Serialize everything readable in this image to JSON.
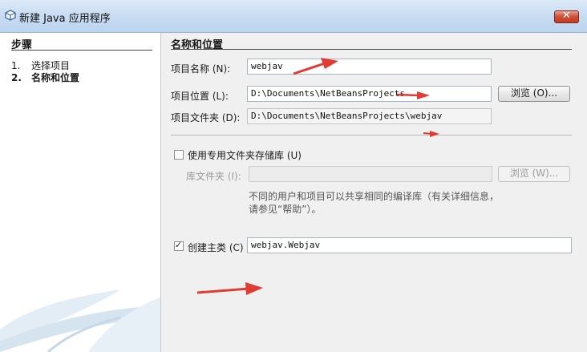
{
  "window": {
    "title": "新建 Java 应用程序",
    "close_glyph": "✕"
  },
  "steps": {
    "title": "步骤",
    "items": [
      {
        "num": "1.",
        "label": "选择项目",
        "current": false
      },
      {
        "num": "2.",
        "label": "名称和位置",
        "current": true
      }
    ]
  },
  "main": {
    "section_title": "名称和位置",
    "project_name": {
      "label": "项目名称 (N):",
      "value": "webjav"
    },
    "project_location": {
      "label": "项目位置 (L):",
      "value": "D:\\Documents\\NetBeansProjects",
      "browse_label": "浏览 (O)..."
    },
    "project_folder": {
      "label": "项目文件夹 (D):",
      "value": "D:\\Documents\\NetBeansProjects\\webjav"
    },
    "dedicated_folder": {
      "label": "使用专用文件夹存储库 (U)",
      "checked": false
    },
    "library_folder": {
      "label": "库文件夹 (I):",
      "value": "",
      "browse_label": "浏览 (W)..."
    },
    "info_text": "不同的用户和项目可以共享相同的编译库（有关详细信息，请参见“帮助”）。",
    "create_main_class": {
      "label": "创建主类 (C)",
      "checked": true,
      "value": "webjav.Webjav"
    }
  },
  "colors": {
    "annotation_arrow": "#e03c32",
    "title_bar": "#c7dbf2",
    "close_button": "#c94a30"
  }
}
